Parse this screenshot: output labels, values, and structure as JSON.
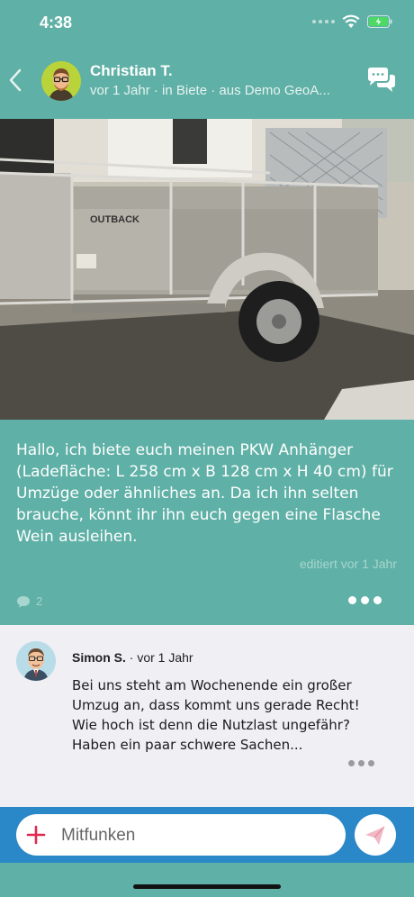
{
  "status_bar": {
    "time": "4:38"
  },
  "header": {
    "author": "Christian T.",
    "subtitle": "vor 1 Jahr · in Biete · aus Demo GeoA..."
  },
  "post": {
    "text": "Hallo, ich biete euch meinen PKW Anhänger (Ladefläche: L 258 cm x B 128 cm x H 40 cm) für Umzüge oder ähnliches an. Da ich ihn selten brauche, könnt ihr ihn euch gegen eine Flasche Wein ausleihen.",
    "edited": "editiert vor 1 Jahr",
    "comment_count": "2",
    "image_brand_text": "OUTBACK"
  },
  "comment": {
    "author": "Simon S.",
    "time": " · vor 1 Jahr",
    "text": "Bei uns steht am Wochenende ein großer Umzug an, dass kommt uns gerade Recht! Wie hoch ist denn die Nutzlast ungefähr? Haben ein paar schwere Sachen..."
  },
  "compose": {
    "placeholder": "Mitfunken"
  },
  "colors": {
    "primary": "#5fb0a6",
    "compose_bar": "#2a87c8",
    "accent_red": "#e0294f"
  }
}
